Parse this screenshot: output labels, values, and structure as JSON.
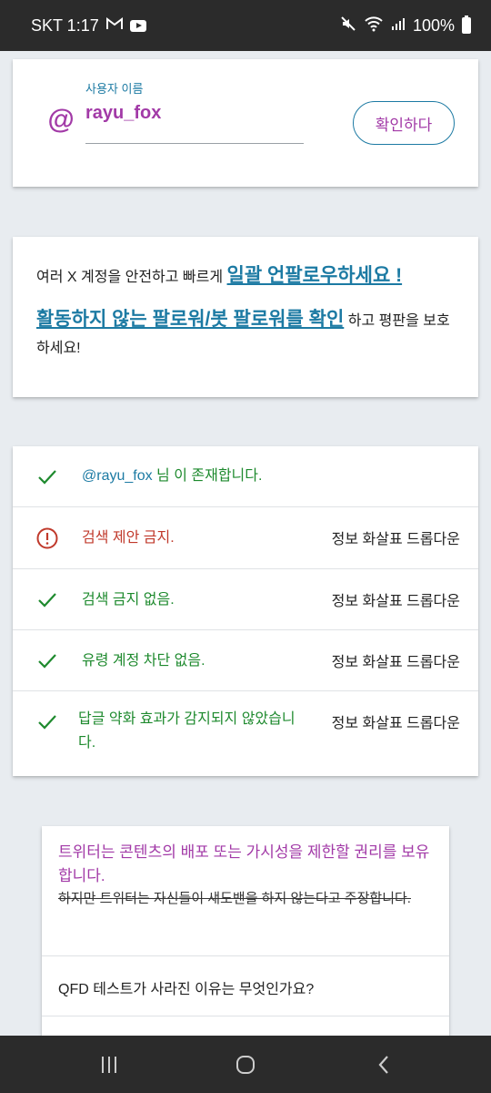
{
  "status_bar": {
    "carrier_time": "SKT 1:17",
    "battery": "100%",
    "icons": [
      "gmail-icon",
      "youtube-icon",
      "mute-icon",
      "wifi-icon",
      "signal-icon",
      "battery-icon"
    ]
  },
  "username_card": {
    "label": "사용자 이름",
    "value": "rayu_fox",
    "button_label": "확인하다"
  },
  "info_card": {
    "line1_prefix": "여러 X 계정을 안전하고 빠르게 ",
    "line1_link": "일괄 언팔로우하세요 !",
    "line2_link": "활동하지 않는 팔로워/봇 팔로워를 확인",
    "line2_suffix": " 하고 평판을 보호하세요!"
  },
  "results": [
    {
      "status": "ok",
      "handle": "@rayu_fox",
      "text": " 님 이 존재합니다.",
      "link": ""
    },
    {
      "status": "error",
      "handle": "",
      "text": "검색 제안 금지.",
      "link": "정보 화살표 드롭다운"
    },
    {
      "status": "ok",
      "handle": "",
      "text": "검색 금지 없음.",
      "link": "정보 화살표 드롭다운"
    },
    {
      "status": "ok",
      "handle": "",
      "text": "유령 계정 차단 없음.",
      "link": "정보 화살표 드롭다운"
    },
    {
      "status": "ok",
      "handle": "",
      "text": "답글 약화 효과가 감지되지 않았습니다.",
      "link": "정보 화살표 드롭다운"
    }
  ],
  "faq_card": {
    "title": "트위터는 콘텐츠의 배포 또는 가시성을 제한할 권리를 보유합니다.",
    "strike_text": "하지만 트위터는 자신들이 섀도밴을 하지 않는다고 주장합니다.",
    "question": "QFD 테스트가 사라진 이유는 무엇인가요?"
  },
  "colors": {
    "accent_purple": "#a23aa7",
    "accent_blue": "#1c7aa3",
    "ok_green": "#1e8a2e",
    "error_red": "#c0392b"
  }
}
